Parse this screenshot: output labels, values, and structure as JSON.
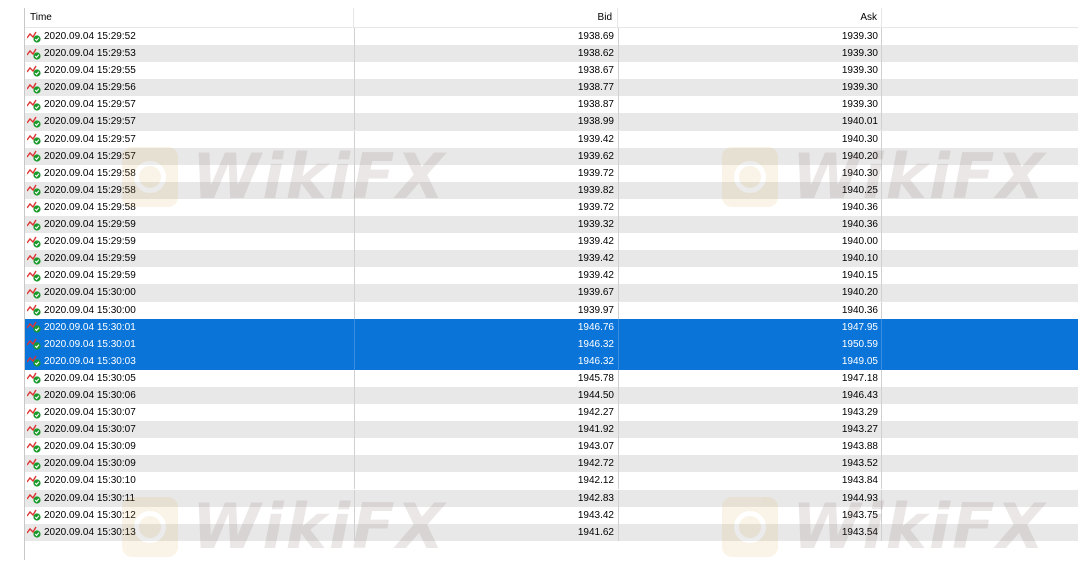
{
  "columns": {
    "time": "Time",
    "bid": "Bid",
    "ask": "Ask"
  },
  "watermark": {
    "text": "WikiFX",
    "color": "#7d5f5f",
    "logo_color": "#e0b25a"
  },
  "colors": {
    "selection": "#0a74d8",
    "stripe": "#e8e8e8"
  },
  "ticks": [
    {
      "time": "2020.09.04 15:29:52",
      "bid": "1938.69",
      "ask": "1939.30",
      "selected": false
    },
    {
      "time": "2020.09.04 15:29:53",
      "bid": "1938.62",
      "ask": "1939.30",
      "selected": false
    },
    {
      "time": "2020.09.04 15:29:55",
      "bid": "1938.67",
      "ask": "1939.30",
      "selected": false
    },
    {
      "time": "2020.09.04 15:29:56",
      "bid": "1938.77",
      "ask": "1939.30",
      "selected": false
    },
    {
      "time": "2020.09.04 15:29:57",
      "bid": "1938.87",
      "ask": "1939.30",
      "selected": false
    },
    {
      "time": "2020.09.04 15:29:57",
      "bid": "1938.99",
      "ask": "1940.01",
      "selected": false
    },
    {
      "time": "2020.09.04 15:29:57",
      "bid": "1939.42",
      "ask": "1940.30",
      "selected": false
    },
    {
      "time": "2020.09.04 15:29:57",
      "bid": "1939.62",
      "ask": "1940.20",
      "selected": false
    },
    {
      "time": "2020.09.04 15:29:58",
      "bid": "1939.72",
      "ask": "1940.30",
      "selected": false
    },
    {
      "time": "2020.09.04 15:29:58",
      "bid": "1939.82",
      "ask": "1940.25",
      "selected": false
    },
    {
      "time": "2020.09.04 15:29:58",
      "bid": "1939.72",
      "ask": "1940.36",
      "selected": false
    },
    {
      "time": "2020.09.04 15:29:59",
      "bid": "1939.32",
      "ask": "1940.36",
      "selected": false
    },
    {
      "time": "2020.09.04 15:29:59",
      "bid": "1939.42",
      "ask": "1940.00",
      "selected": false
    },
    {
      "time": "2020.09.04 15:29:59",
      "bid": "1939.42",
      "ask": "1940.10",
      "selected": false
    },
    {
      "time": "2020.09.04 15:29:59",
      "bid": "1939.42",
      "ask": "1940.15",
      "selected": false
    },
    {
      "time": "2020.09.04 15:30:00",
      "bid": "1939.67",
      "ask": "1940.20",
      "selected": false
    },
    {
      "time": "2020.09.04 15:30:00",
      "bid": "1939.97",
      "ask": "1940.36",
      "selected": false
    },
    {
      "time": "2020.09.04 15:30:01",
      "bid": "1946.76",
      "ask": "1947.95",
      "selected": true
    },
    {
      "time": "2020.09.04 15:30:01",
      "bid": "1946.32",
      "ask": "1950.59",
      "selected": true
    },
    {
      "time": "2020.09.04 15:30:03",
      "bid": "1946.32",
      "ask": "1949.05",
      "selected": true
    },
    {
      "time": "2020.09.04 15:30:05",
      "bid": "1945.78",
      "ask": "1947.18",
      "selected": false
    },
    {
      "time": "2020.09.04 15:30:06",
      "bid": "1944.50",
      "ask": "1946.43",
      "selected": false
    },
    {
      "time": "2020.09.04 15:30:07",
      "bid": "1942.27",
      "ask": "1943.29",
      "selected": false
    },
    {
      "time": "2020.09.04 15:30:07",
      "bid": "1941.92",
      "ask": "1943.27",
      "selected": false
    },
    {
      "time": "2020.09.04 15:30:09",
      "bid": "1943.07",
      "ask": "1943.88",
      "selected": false
    },
    {
      "time": "2020.09.04 15:30:09",
      "bid": "1942.72",
      "ask": "1943.52",
      "selected": false
    },
    {
      "time": "2020.09.04 15:30:10",
      "bid": "1942.12",
      "ask": "1943.84",
      "selected": false
    },
    {
      "time": "2020.09.04 15:30:11",
      "bid": "1942.83",
      "ask": "1944.93",
      "selected": false
    },
    {
      "time": "2020.09.04 15:30:12",
      "bid": "1943.42",
      "ask": "1943.75",
      "selected": false
    },
    {
      "time": "2020.09.04 15:30:13",
      "bid": "1941.62",
      "ask": "1943.54",
      "selected": false
    }
  ]
}
